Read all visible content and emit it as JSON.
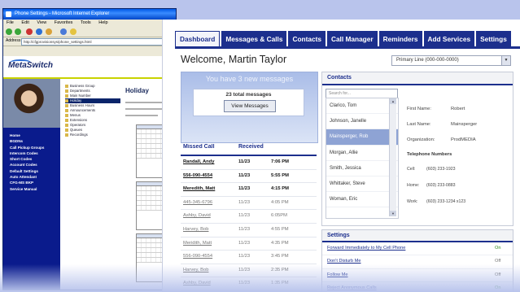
{
  "browser": {
    "title": "Phone Settings - Microsoft Internet Explorer",
    "menu": [
      "File",
      "Edit",
      "View",
      "Favorites",
      "Tools",
      "Help"
    ],
    "address_label": "Address",
    "address": "http://cfgprovisionsys/phone_settings.html",
    "brand": "MetaSwitch",
    "sidebar": [
      "Home",
      "BGDNs",
      "Call Pickup Groups",
      "Intercom Codes",
      "Short Codes",
      "Account Codes",
      "Default Settings",
      "Auto Attendant",
      "CFG-MS BKP",
      "Service Manual"
    ],
    "tree": [
      "Business Group",
      "Departments",
      "Main Number",
      "Holiday",
      "Business Hours",
      "Announcements",
      "Menus",
      "Extensions",
      "Operators",
      "Queues",
      "Recordings"
    ],
    "page_title": "Holiday"
  },
  "app": {
    "tabs": [
      "Dashboard",
      "Messages & Calls",
      "Contacts",
      "Call Manager",
      "Reminders",
      "Add Services",
      "Settings"
    ],
    "welcome": "Welcome, Martin Taylor",
    "line_select": "Primary Line (000-000-0000)",
    "messages": {
      "header": "You have 3 new messages",
      "count": "23 total messages",
      "button": "View Messages"
    },
    "missed_calls": {
      "headers": [
        "Missed Call",
        "Received",
        ""
      ],
      "rows": [
        {
          "name": "Randall, Andy",
          "date": "11/23",
          "time": "7:06 PM",
          "bold": true
        },
        {
          "name": "556-090-4554",
          "date": "11/23",
          "time": "5:55 PM",
          "bold": true
        },
        {
          "name": "Meredith, Matt",
          "date": "11/23",
          "time": "4:15 PM",
          "bold": true
        },
        {
          "name": "445-345-6796",
          "date": "11/23",
          "time": "4:05 PM",
          "bold": false
        },
        {
          "name": "Ashby, David",
          "date": "11/23",
          "time": "6:05PM",
          "bold": false
        },
        {
          "name": "Harvey, Bob",
          "date": "11/23",
          "time": "4:55 PM",
          "bold": false
        },
        {
          "name": "Meridith, Matt",
          "date": "11/23",
          "time": "4:35 PM",
          "bold": false
        },
        {
          "name": "556-090-4554",
          "date": "11/23",
          "time": "3:45 PM",
          "bold": false
        },
        {
          "name": "Harvey, Bob",
          "date": "11/23",
          "time": "2:35 PM",
          "bold": false
        },
        {
          "name": "Ashby, David",
          "date": "11/23",
          "time": "1:35 PM",
          "bold": false
        }
      ]
    },
    "contacts": {
      "header": "Contacts",
      "search_placeholder": "Search for...",
      "list": [
        "Clarico, Tom",
        "Johnson, Janelle",
        "Mainsperger, Rob",
        "Morgan, Allie",
        "Smith, Jessica",
        "Whittaker, Steve",
        "Woman, Eric"
      ],
      "selected_index": 2,
      "detail": {
        "first_name_label": "First Name:",
        "first_name": "Robert",
        "last_name_label": "Last Name:",
        "last_name": "Mainsperger",
        "org_label": "Organization:",
        "org": "ProdMEDIA",
        "phones_label": "Telephone Numbers",
        "cell_label": "Cell:",
        "cell": "(603) 233-1923",
        "home_label": "Home:",
        "home": "(603) 233-0883",
        "work_label": "Work:",
        "work": "(603) 233-1234 x123"
      }
    },
    "settings": {
      "header": "Settings",
      "rows": [
        {
          "label": "Forward Immediately to My Cell Phone",
          "value": "On",
          "state": "on"
        },
        {
          "label": "Don't Disturb Me",
          "value": "Off",
          "state": "off"
        },
        {
          "label": "Follow Me",
          "value": "Off",
          "state": "off"
        },
        {
          "label": "Reject Anonymous Calls",
          "value": "On",
          "state": "on"
        }
      ]
    }
  },
  "colors": {
    "tab_bg": "#1c2f8d",
    "banner": "#b9c4ec",
    "sidebar": "#0a1b8c",
    "selected_contact": "#8ea3d4"
  }
}
